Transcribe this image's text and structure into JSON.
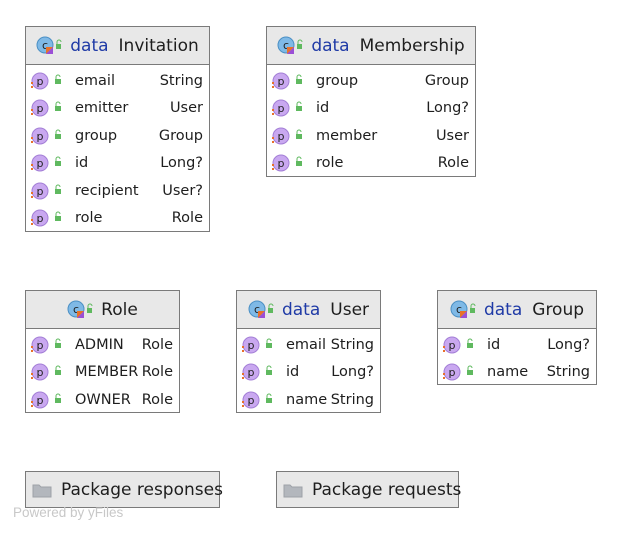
{
  "classes": {
    "invitation": {
      "keyword": "data",
      "name": "Invitation",
      "fields": [
        {
          "name": "email",
          "type": "String"
        },
        {
          "name": "emitter",
          "type": "User"
        },
        {
          "name": "group",
          "type": "Group"
        },
        {
          "name": "id",
          "type": "Long?"
        },
        {
          "name": "recipient",
          "type": "User?"
        },
        {
          "name": "role",
          "type": "Role"
        }
      ]
    },
    "membership": {
      "keyword": "data",
      "name": "Membership",
      "fields": [
        {
          "name": "group",
          "type": "Group"
        },
        {
          "name": "id",
          "type": "Long?"
        },
        {
          "name": "member",
          "type": "User"
        },
        {
          "name": "role",
          "type": "Role"
        }
      ]
    },
    "role": {
      "name": "Role",
      "fields": [
        {
          "name": "ADMIN",
          "type": "Role"
        },
        {
          "name": "MEMBER",
          "type": "Role"
        },
        {
          "name": "OWNER",
          "type": "Role"
        }
      ]
    },
    "user": {
      "keyword": "data",
      "name": "User",
      "fields": [
        {
          "name": "email",
          "type": "String"
        },
        {
          "name": "id",
          "type": "Long?"
        },
        {
          "name": "name",
          "type": "String"
        }
      ]
    },
    "group": {
      "keyword": "data",
      "name": "Group",
      "fields": [
        {
          "name": "id",
          "type": "Long?"
        },
        {
          "name": "name",
          "type": "String"
        }
      ]
    }
  },
  "packages": {
    "responses": "Package responses",
    "requests": "Package requests"
  },
  "watermark": "Powered by yFiles",
  "icons": {
    "class": "kotlin-class-icon",
    "property": "property-icon",
    "access": "public-lock-icon",
    "package": "folder-icon"
  },
  "colors": {
    "header_bg": "#e8e8e8",
    "border": "#7a7a7a",
    "keyword": "#1f3aa6",
    "property_circle": "#c9a8f0",
    "class_circle": "#7fb9e6",
    "lock_green": "#5fb95f",
    "watermark": "#c8c8c8"
  }
}
